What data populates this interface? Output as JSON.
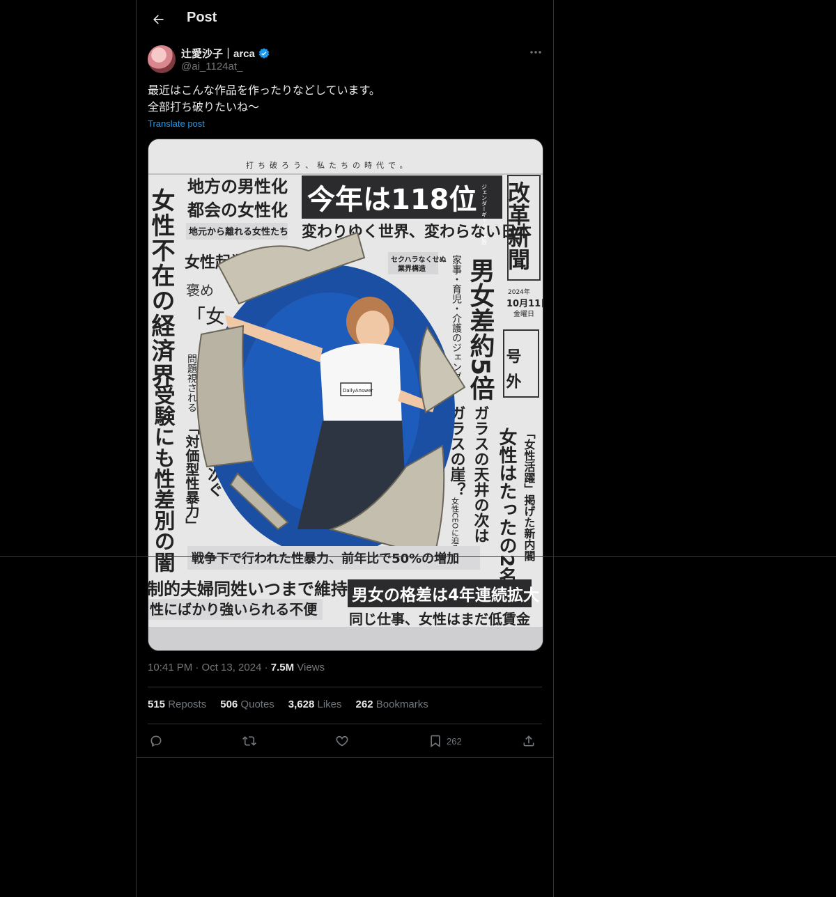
{
  "header": {
    "title": "Post",
    "back_icon": "arrow-left-icon"
  },
  "author": {
    "name": "辻愛沙子｜arca",
    "handle": "@ai_1124at_",
    "verified": true,
    "verified_color": "#1d9bf0"
  },
  "post": {
    "text_line1": "最近はこんな作品を作ったりなどしています。",
    "text_line2": "全部打ち破りたいね〜",
    "translate_label": "Translate post"
  },
  "media": {
    "top_tagline": "打ち破ろう、私たちの時代で。",
    "headline_main": "今年は118位",
    "headline_main_tag": "ジェンダーギャップ指数",
    "sub_headline": "変わりゆく世界、変わらない日本",
    "left_col1": "女性不在の経済界",
    "left_col2": "受験にも性差別の闇",
    "top_left_1": "地方の男性化",
    "top_left_2": "都会の女性化",
    "top_left_3": "地元から離れる女性たち",
    "mid_left_1": "女性起業家",
    "mid_left_2": "褒め",
    "mid_left_3": "「女",
    "mid_col_a": "問題視される",
    "mid_col_b": "「対価型性暴力」",
    "mid_col_c": "被害相次ぐ",
    "right_masthead": "改革新聞",
    "date_year": "2024年",
    "date_day": "10月11日",
    "date_weekday": "金曜日",
    "extra_label": "号外",
    "right_col_big": "男女差約5倍",
    "right_col_small": "家事・育児・介護のジェンダ",
    "sekuhara_1": "セクハラなくせぬ",
    "sekuhara_2": "業界構造",
    "glass_1": "ガラスの天井の次は",
    "glass_2": "ガラスの崖？",
    "ceo_text": "女性CEOに迫る困難",
    "cabinet_1": "「女性活躍」掲げた新内閣",
    "cabinet_2": "女性はたったの2名",
    "bottom_war": "戦争下で行われた性暴力、前年比で50%の増加",
    "bottom_left_1": "制的夫婦同姓いつまで維持？",
    "bottom_left_2": "性にばかり強いられる不便",
    "bottom_right_1": "男女の格差は4年連続拡大",
    "bottom_right_2": "同じ仕事、女性はまだ低賃金",
    "shirt_text": "DailyAnswer"
  },
  "meta": {
    "time": "10:41 PM · Oct 13, 2024 · ",
    "views_count": "7.5M",
    "views_label": " Views"
  },
  "stats": {
    "reposts_count": "515",
    "reposts_label": " Reposts",
    "quotes_count": "506",
    "quotes_label": " Quotes",
    "likes_count": "3,628",
    "likes_label": " Likes",
    "bookmarks_count": "262",
    "bookmarks_label": " Bookmarks"
  },
  "actions": {
    "reply_icon": "reply-icon",
    "repost_icon": "repost-icon",
    "like_icon": "heart-icon",
    "bookmark_icon": "bookmark-icon",
    "bookmark_count": "262",
    "share_icon": "share-icon"
  }
}
